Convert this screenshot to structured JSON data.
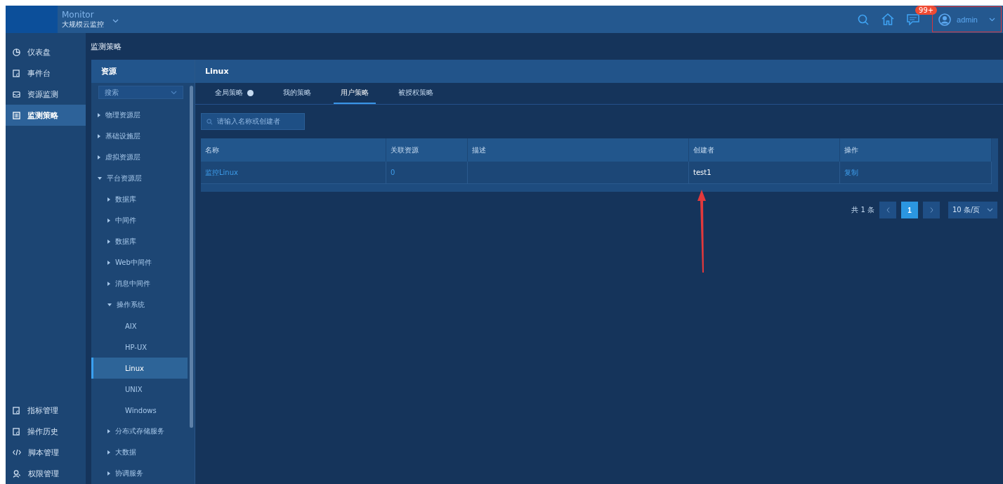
{
  "header": {
    "brand": "Monitor",
    "subtitle": "大规模云监控",
    "badge": "99+",
    "user": "admin"
  },
  "nav": {
    "top": [
      {
        "label": "仪表盘",
        "selected": false
      },
      {
        "label": "事件台",
        "selected": false
      },
      {
        "label": "资源监测",
        "selected": false
      },
      {
        "label": "监测策略",
        "selected": true
      }
    ],
    "bottom": [
      {
        "label": "指标管理",
        "selected": false
      },
      {
        "label": "操作历史",
        "selected": false
      },
      {
        "label": "脚本管理",
        "selected": false
      },
      {
        "label": "权限管理",
        "selected": false
      }
    ]
  },
  "breadcrumb": "监测策略",
  "tree": {
    "title": "资源",
    "search_placeholder": "搜索",
    "items": [
      {
        "label": "物理资源层",
        "expanded": false,
        "selected": false
      },
      {
        "label": "基础设施层",
        "expanded": false,
        "selected": false
      },
      {
        "label": "虚拟资源层",
        "expanded": false,
        "selected": false
      },
      {
        "label": "平台资源层",
        "expanded": true,
        "selected": false,
        "children": [
          {
            "label": "数据库",
            "expanded": false,
            "selected": false
          },
          {
            "label": "中间件",
            "expanded": false,
            "selected": false
          },
          {
            "label": "数据库",
            "expanded": false,
            "selected": false
          },
          {
            "label": "Web中间件",
            "expanded": false,
            "selected": false
          },
          {
            "label": "消息中间件",
            "expanded": false,
            "selected": false
          },
          {
            "label": "操作系统",
            "expanded": true,
            "selected": false,
            "children": [
              {
                "label": "AIX",
                "selected": false
              },
              {
                "label": "HP-UX",
                "selected": false
              },
              {
                "label": "Linux",
                "selected": true
              },
              {
                "label": "UNIX",
                "selected": false
              },
              {
                "label": "Windows",
                "selected": false
              }
            ]
          },
          {
            "label": "分布式存储服务",
            "expanded": false,
            "selected": false
          },
          {
            "label": "大数据",
            "expanded": false,
            "selected": false
          },
          {
            "label": "协调服务",
            "expanded": false,
            "selected": false
          }
        ]
      }
    ]
  },
  "panel": {
    "title": "Linux",
    "tabs": [
      {
        "label": "全局策略",
        "help": true,
        "selected": false
      },
      {
        "label": "我的策略",
        "help": false,
        "selected": false
      },
      {
        "label": "用户策略",
        "help": false,
        "selected": true
      },
      {
        "label": "被授权策略",
        "help": false,
        "selected": false
      }
    ],
    "search_placeholder": "请输入名称或创建者",
    "table": {
      "columns": [
        "名称",
        "关联资源",
        "描述",
        "创建者",
        "操作"
      ],
      "rows": [
        [
          "监控Linux",
          "0",
          "",
          "test1",
          "复制"
        ]
      ]
    },
    "pagination": {
      "total": "共 1 条",
      "pages": [
        {
          "label": "1",
          "selected": true
        }
      ],
      "page_size": "10 条/页"
    }
  }
}
